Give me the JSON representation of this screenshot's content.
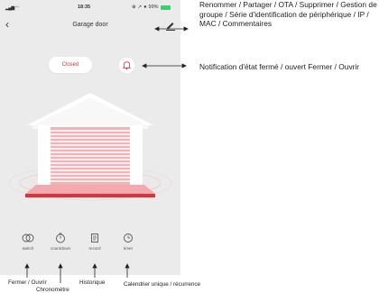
{
  "status_bar": {
    "time": "18:35",
    "battery": "99%"
  },
  "header": {
    "back_icon": "‹",
    "title": "Garage door"
  },
  "door": {
    "status_label": "Closed"
  },
  "actions": [
    {
      "label": "switch",
      "icon": "switch-icon"
    },
    {
      "label": "countdown",
      "icon": "countdown-icon"
    },
    {
      "label": "record",
      "icon": "record-icon"
    },
    {
      "label": "timer",
      "icon": "timer-icon"
    }
  ],
  "annotations": {
    "edit_menu": "Renommer / Partager / OTA / Supprimer / Gestion de groupe / Série d'identification de périphérique / IP / MAC / Commentaires",
    "notification": "Notification d'état fermé / ouvert Fermer / Ouvrir",
    "switch": "Fermer / Ouvrir",
    "countdown": "Chronomètre",
    "record": "Historique",
    "timer": "Calendrier unique / récurrence"
  },
  "colors": {
    "accent": "#e0303c",
    "background": "#ebebeb",
    "door_light": "#f5b7bb"
  }
}
